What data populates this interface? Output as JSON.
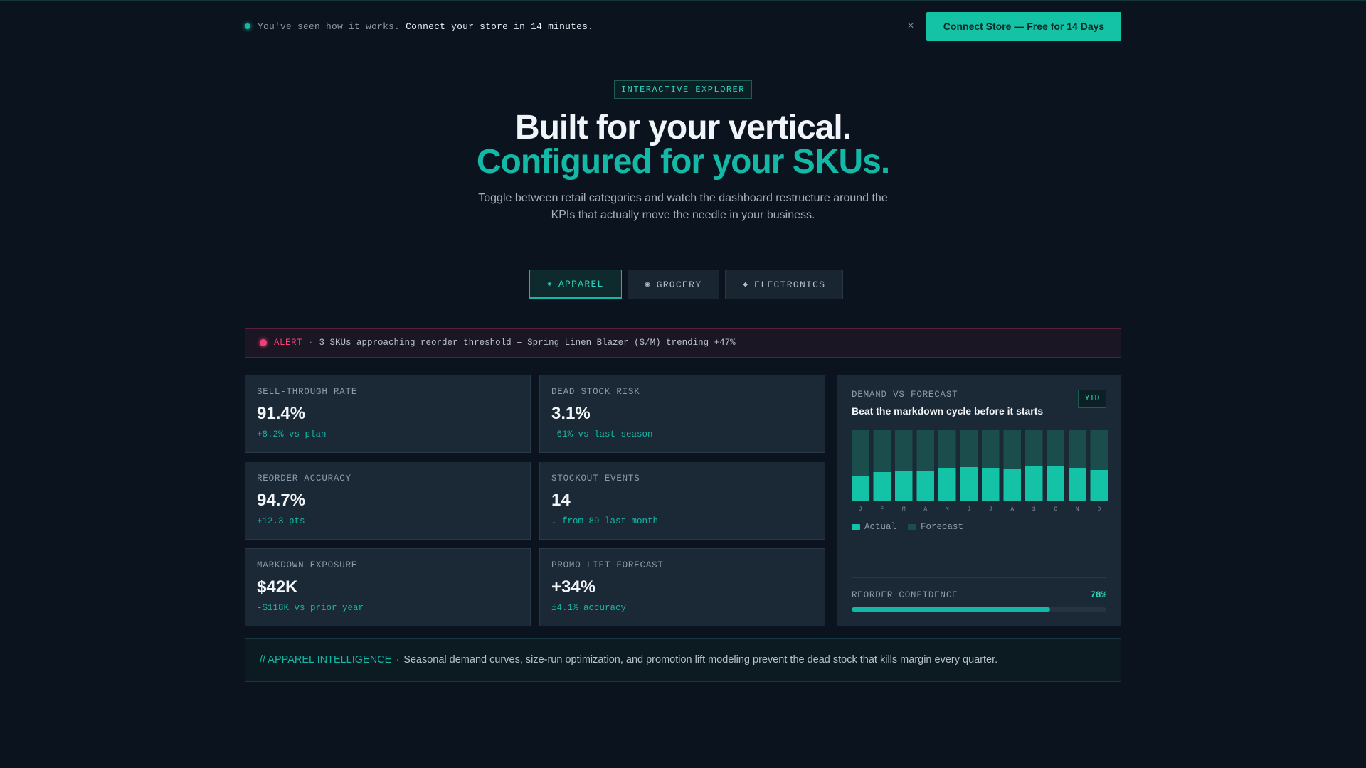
{
  "banner": {
    "message": "You've seen how it works.",
    "message_emphasis": "Connect your store in 14 minutes.",
    "close": "×",
    "cta": "Connect Store — Free for 14 Days"
  },
  "hero": {
    "eyebrow": "INTERACTIVE EXPLORER",
    "title_line1": "Built for your vertical.",
    "title_line2": "Configured for your SKUs.",
    "subtitle": "Toggle between retail categories and watch the dashboard restructure around the KPIs that actually move the needle in your business."
  },
  "tabs": [
    {
      "icon": "◈",
      "label": "APPAREL",
      "active": true
    },
    {
      "icon": "◉",
      "label": "GROCERY",
      "active": false
    },
    {
      "icon": "◆",
      "label": "ELECTRONICS",
      "active": false
    }
  ],
  "alert": {
    "tag": "ALERT",
    "separator": "·",
    "text": "3 SKUs approaching reorder threshold — Spring Linen Blazer (S/M) trending +47%"
  },
  "kpis": [
    {
      "label": "SELL-THROUGH RATE",
      "value": "91.4%",
      "delta": "+8.2% vs plan"
    },
    {
      "label": "DEAD STOCK RISK",
      "value": "3.1%",
      "delta": "-61% vs last season"
    },
    {
      "label": "REORDER ACCURACY",
      "value": "94.7%",
      "delta": "+12.3 pts"
    },
    {
      "label": "STOCKOUT EVENTS",
      "value": "14",
      "delta": "↓ from 89 last month"
    },
    {
      "label": "MARKDOWN EXPOSURE",
      "value": "$42K",
      "delta": "-$118K vs prior year"
    },
    {
      "label": "PROMO LIFT FORECAST",
      "value": "+34%",
      "delta": "±4.1% accuracy"
    }
  ],
  "panel": {
    "label": "DEMAND VS FORECAST",
    "title": "Beat the markdown cycle before it starts",
    "badge": "YTD",
    "legend_actual": "Actual",
    "legend_forecast": "Forecast",
    "confidence_label": "REORDER CONFIDENCE",
    "confidence_value": "78%",
    "confidence_fraction": 0.78
  },
  "chart_data": {
    "type": "bar",
    "categories": [
      "J",
      "F",
      "M",
      "A",
      "M",
      "J",
      "J",
      "A",
      "S",
      "O",
      "N",
      "D"
    ],
    "series": [
      {
        "name": "Forecast",
        "values": [
          100,
          100,
          100,
          100,
          100,
          100,
          100,
          100,
          100,
          100,
          100,
          100
        ]
      },
      {
        "name": "Actual",
        "values": [
          35,
          40,
          42,
          41,
          46,
          47,
          46,
          44,
          48,
          49,
          46,
          43
        ]
      }
    ],
    "ylim": [
      0,
      100
    ],
    "colors": {
      "actual": "#14c2a6",
      "forecast": "#1b4d4c"
    }
  },
  "footer": {
    "tag": "// APPAREL INTELLIGENCE",
    "separator": "·",
    "text": "Seasonal demand curves, size-run optimization, and promotion lift modeling prevent the dead stock that kills margin every quarter."
  }
}
